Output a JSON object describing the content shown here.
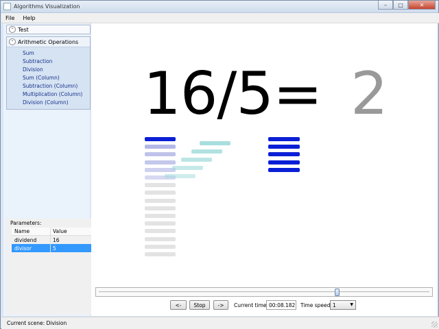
{
  "window": {
    "title": "Algorithms Visualization"
  },
  "icons": {
    "window_min": "minimize-icon",
    "window_max": "maximize-icon",
    "window_close": "close-icon",
    "collapse": "chevron-up-icon",
    "dropdown": "chevron-down-icon"
  },
  "window_buttons": {
    "min": "–",
    "max": "□",
    "close": "✕"
  },
  "menu": [
    "File",
    "Help"
  ],
  "tree": {
    "group1": "Test",
    "group2": "Arithmetic Operations",
    "group_glyph": "⌃",
    "items": [
      "Sum",
      "Subtraction",
      "Division",
      "Sum (Column)",
      "Subtraction (Column)",
      "Multiplication (Column)",
      "Division (Column)"
    ]
  },
  "parameters": {
    "label": "Parameters:",
    "columns": [
      "Name",
      "Value"
    ],
    "rows": [
      {
        "name": "dividend",
        "value": "16"
      },
      {
        "name": "divisor",
        "value": "5"
      }
    ]
  },
  "scene": {
    "expression": "16/5=",
    "result": "2",
    "colors": {
      "expression": "#000000",
      "result": "#999999",
      "dividend_blue": "#0a1fd6",
      "faded_blue": "#8a92d8",
      "remainder_gray": "#e3e3e3",
      "moving_teal": "#9fdada"
    }
  },
  "playback": {
    "back_label": "<-",
    "stop_label": "Stop",
    "forward_label": "->",
    "current_time_label": "Current time:",
    "current_time": "00:08.182",
    "speed_label": "Time speed:",
    "speed_value": "1",
    "progress": 0.72
  },
  "status": {
    "text": "Current scene:  Division"
  }
}
